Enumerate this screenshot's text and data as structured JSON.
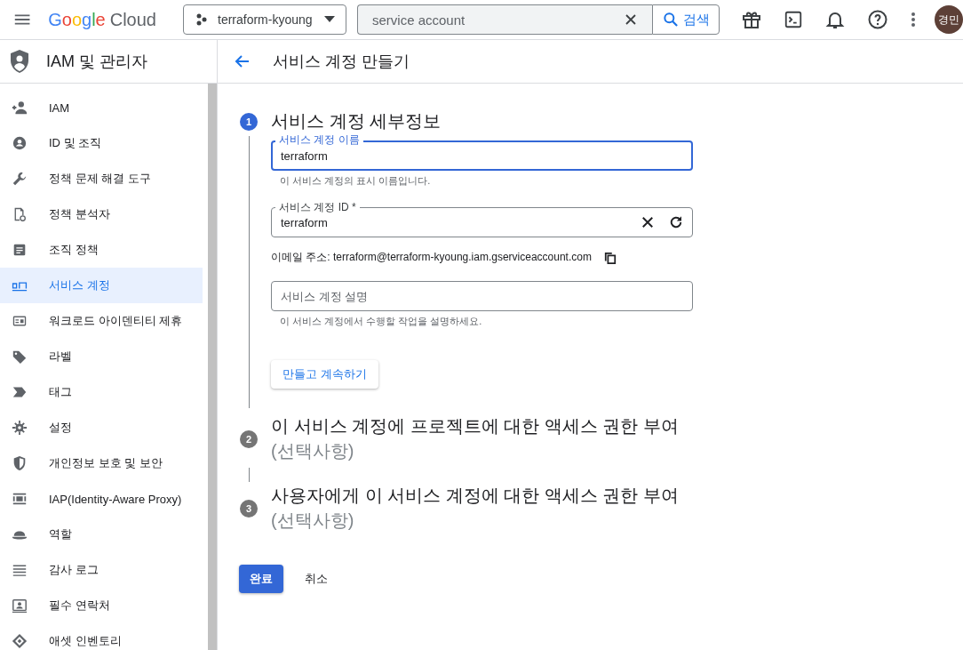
{
  "topbar": {
    "logo_google": "Google",
    "logo_cloud": "Cloud",
    "project": "terraform-kyoung",
    "search": {
      "value": "service account",
      "button": "검색"
    },
    "avatar": "경민"
  },
  "sidebar": {
    "title": "IAM 및 관리자",
    "items": [
      {
        "label": "IAM",
        "selected": false
      },
      {
        "label": "ID 및 조직",
        "selected": false
      },
      {
        "label": "정책 문제 해결 도구",
        "selected": false
      },
      {
        "label": "정책 분석자",
        "selected": false
      },
      {
        "label": "조직 정책",
        "selected": false
      },
      {
        "label": "서비스 계정",
        "selected": true
      },
      {
        "label": "워크로드 아이덴티티 제휴",
        "selected": false
      },
      {
        "label": "라벨",
        "selected": false
      },
      {
        "label": "태그",
        "selected": false
      },
      {
        "label": "설정",
        "selected": false
      },
      {
        "label": "개인정보 보호 및 보안",
        "selected": false
      },
      {
        "label": "IAP(Identity-Aware Proxy)",
        "selected": false
      },
      {
        "label": "역할",
        "selected": false
      },
      {
        "label": "감사 로그",
        "selected": false
      },
      {
        "label": "필수 연락처",
        "selected": false
      },
      {
        "label": "애셋 인벤토리",
        "selected": false
      }
    ]
  },
  "page": {
    "title": "서비스 계정 만들기"
  },
  "steps": [
    {
      "number": "1",
      "title": "서비스 계정 세부정보",
      "active": true
    },
    {
      "number": "2",
      "title": "이 서비스 계정에 프로젝트에 대한 액세스 권한 부여",
      "subtitle": "(선택사항)",
      "active": false
    },
    {
      "number": "3",
      "title": "사용자에게 이 서비스 계정에 대한 액세스 권한 부여",
      "subtitle": "(선택사항)",
      "active": false
    }
  ],
  "details": {
    "name_field": {
      "label": "서비스 계정 이름",
      "value": "terraform",
      "hint": "이 서비스 계정의 표시 이름입니다.",
      "focused": true
    },
    "id_field": {
      "label": "서비스 계정 ID *",
      "value": "terraform",
      "focused": false
    },
    "email": "이메일 주소: terraform@terraform-kyoung.iam.gserviceaccount.com",
    "description_field": {
      "placeholder": "서비스 계정 설명",
      "hint": "이 서비스 계정에서 수행할 작업을 설명하세요."
    },
    "continue_button": "만들고 계속하기"
  },
  "actions": {
    "done": "완료",
    "cancel": "취소"
  }
}
